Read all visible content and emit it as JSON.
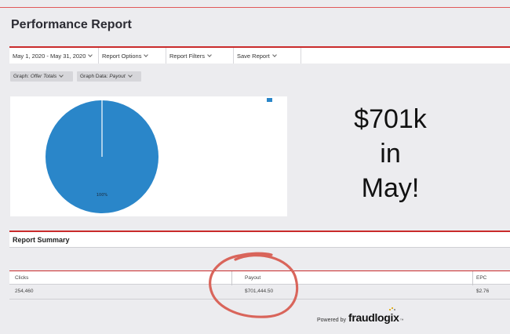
{
  "page": {
    "title": "Performance Report"
  },
  "toolbar": {
    "date_range": "May 1, 2020 - May 31, 2020",
    "report_options": "Report Options",
    "report_filters": "Report Filters",
    "save_report": "Save Report"
  },
  "graph_controls": {
    "graph_label": "Graph:",
    "graph_value": "Offer Totals",
    "data_label": "Graph Data:",
    "data_value": "Payout"
  },
  "chart_data": {
    "type": "pie",
    "labels": [
      "100%"
    ],
    "values": [
      100
    ],
    "colors": [
      "#2a86c9"
    ],
    "legend_position": "top-right"
  },
  "annotation": {
    "line1": "$701k",
    "line2": "in",
    "line3": "May!",
    "circle_color": "#d9655b"
  },
  "summary": {
    "title": "Report Summary",
    "columns": [
      "Clicks",
      "Payout",
      "EPC"
    ],
    "rows": [
      [
        "254,460",
        "$701,444.50",
        "$2.76"
      ]
    ]
  },
  "footer": {
    "powered_by": "Powered by",
    "brand_name": "fraudlogix",
    "trademark": "™"
  },
  "colors": {
    "accent": "#c92b2b",
    "pie": "#2a86c9"
  },
  "icons": [
    "chevron-down-icon"
  ]
}
